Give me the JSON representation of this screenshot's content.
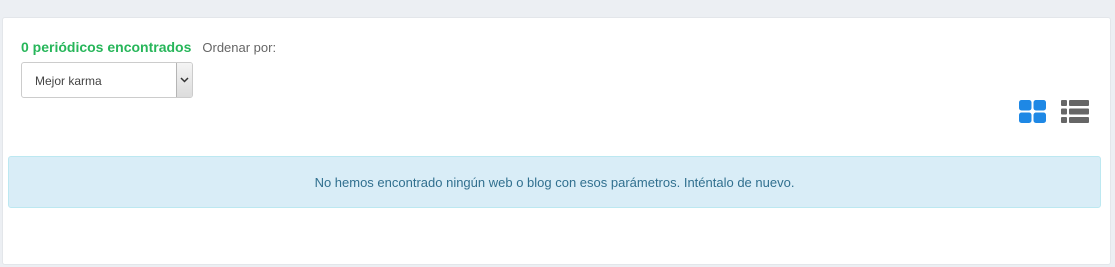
{
  "results": {
    "count_text": "0 periódicos encontrados",
    "order_label": "Ordenar por:"
  },
  "sort": {
    "selected": "Mejor karma"
  },
  "view_toggle": {
    "grid_icon": "grid-view-icon",
    "list_icon": "list-view-icon",
    "grid_color": "#1e88e5",
    "list_color": "#666666"
  },
  "alert": {
    "message": "No hemos encontrado ningún web o blog con esos parámetros. Inténtalo de nuevo."
  }
}
